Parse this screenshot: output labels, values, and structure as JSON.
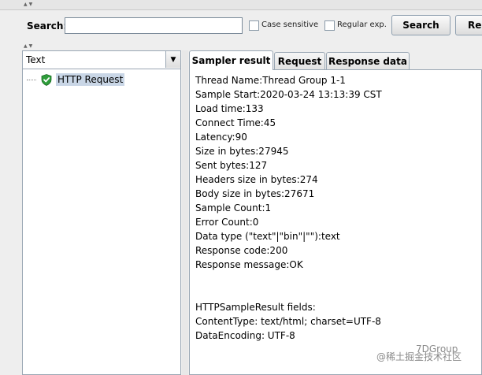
{
  "search": {
    "label": "Search:",
    "value": "",
    "case_sensitive_label": "Case sensitive",
    "regex_label": "Regular exp.",
    "search_button": "Search",
    "next_button": "Re"
  },
  "tree": {
    "renderer": "Text",
    "items": [
      {
        "label": "HTTP Request",
        "status": "success",
        "icon": "shield-check-icon"
      }
    ]
  },
  "tabs": [
    {
      "label": "Sampler result",
      "active": true
    },
    {
      "label": "Request",
      "active": false
    },
    {
      "label": "Response data",
      "active": false
    }
  ],
  "sampler_result": {
    "lines": [
      "Thread Name:Thread Group 1-1",
      "Sample Start:2020-03-24 13:13:39 CST",
      "Load time:133",
      "Connect Time:45",
      "Latency:90",
      "Size in bytes:27945",
      "Sent bytes:127",
      "Headers size in bytes:274",
      "Body size in bytes:27671",
      "Sample Count:1",
      "Error Count:0",
      "Data type (\"text\"|\"bin\"|\"\"):text",
      "Response code:200",
      "Response message:OK",
      "",
      "",
      "HTTPSampleResult fields:",
      "ContentType: text/html; charset=UTF-8",
      "DataEncoding: UTF-8"
    ]
  },
  "watermark": {
    "channel": "7DGroup",
    "source": "@稀土掘金技术社区"
  },
  "colors": {
    "selection": "#c9d6e6",
    "success_icon": "#2e9d3a",
    "border": "#9aa7b4"
  }
}
